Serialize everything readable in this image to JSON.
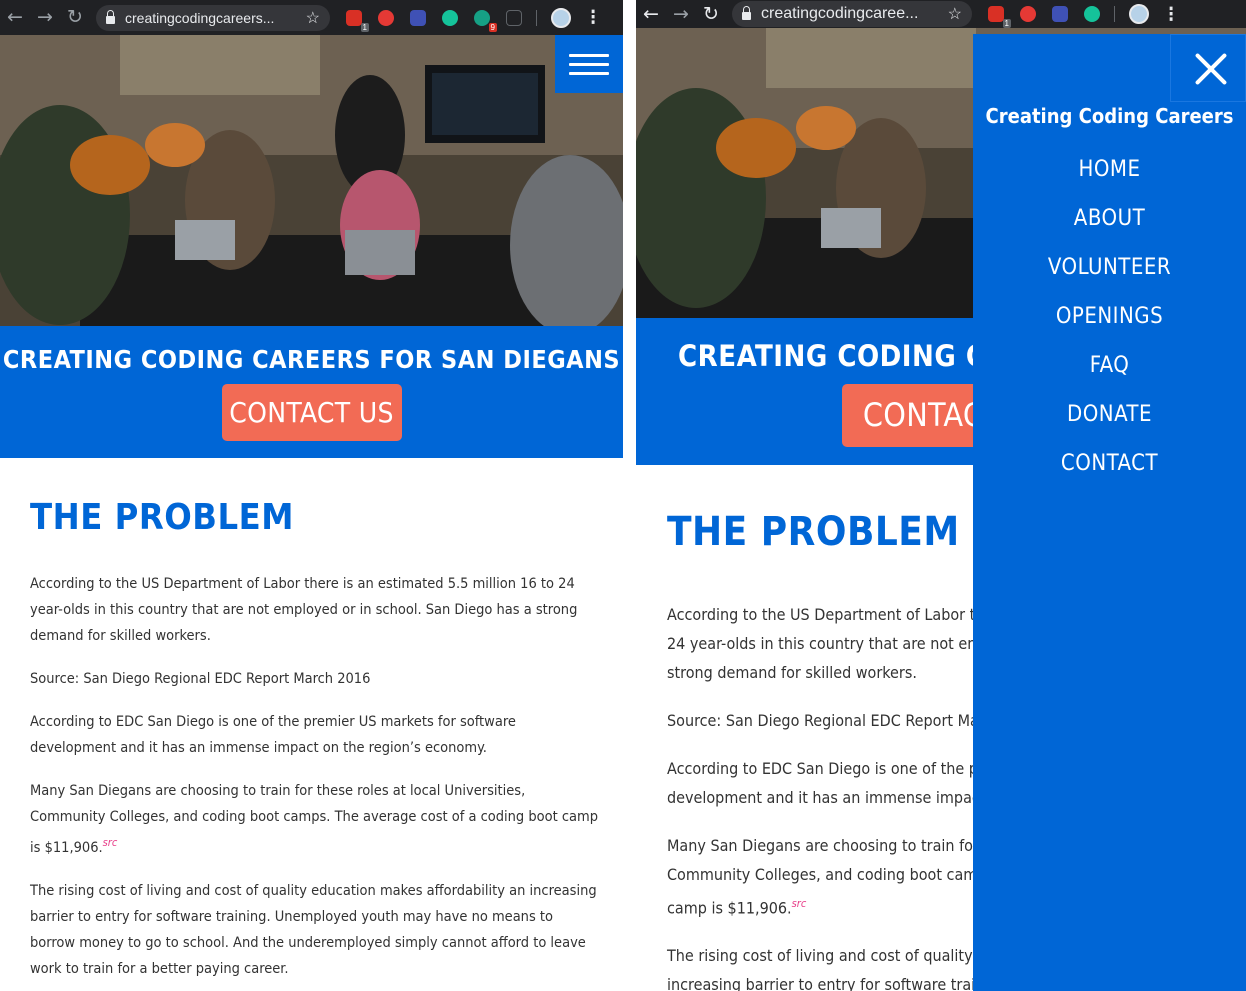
{
  "browser": {
    "url": "creatingcodingcareers.org",
    "url_left": "creatingcodingcareers...",
    "url_right": "creatingcodingcaree...",
    "ext_badge_1": "1",
    "ext_badge_2": "9"
  },
  "site": {
    "banner_title": "CREATING CODING CAREERS FOR SAN DIEGANS",
    "banner_title_right": "CREATING CODING CAREEF",
    "cta_label": "CONTACT US",
    "cta_label_right": "CONTACT",
    "section_title": "THE PROBLEM",
    "left_paras": [
      "According to the US Department of Labor there is an estimated 5.5 million 16 to 24 year-olds in this country that are not employed or in school. San Diego has a strong demand for skilled workers.",
      "Source: San Diego Regional EDC Report March 2016",
      "According to EDC San Diego is one of the premier US markets for software development and it has an immense impact on the region’s economy.",
      "Many San Diegans are choosing to train for these roles at local Universities, Community Colleges, and coding boot camps. The average cost of a coding boot camp is $11,906.",
      "The rising cost of living and cost of quality education makes affordability an increasing barrier to entry for software training. Unemployed youth may have no means to borrow money to go to school. And the underemployed simply cannot afford to leave work to train for a better paying career."
    ],
    "src_label": "src",
    "right_paras": [
      "According to the US Department of Labor ther\n24 year-olds in this country that are not empl\nstrong demand for skilled workers.",
      "Source: San Diego Regional EDC Report March",
      "According to EDC San Diego is one of the pren\ndevelopment and it has an immense impact o",
      "Many San Diegans are choosing to train for th\nCommunity Colleges, and coding boot camps.\ncamp is $11,906.",
      "The rising cost of living and cost of quality ec\nincreasing barrier to entry for software trainin"
    ]
  },
  "menu": {
    "brand": "Creating Coding Careers",
    "items": [
      "HOME",
      "ABOUT",
      "VOLUNTEER",
      "OPENINGS",
      "FAQ",
      "DONATE",
      "CONTACT"
    ]
  },
  "colors": {
    "brand_blue": "#0066d6",
    "cta_coral": "#f26b55",
    "link_pink": "#e8408a"
  }
}
